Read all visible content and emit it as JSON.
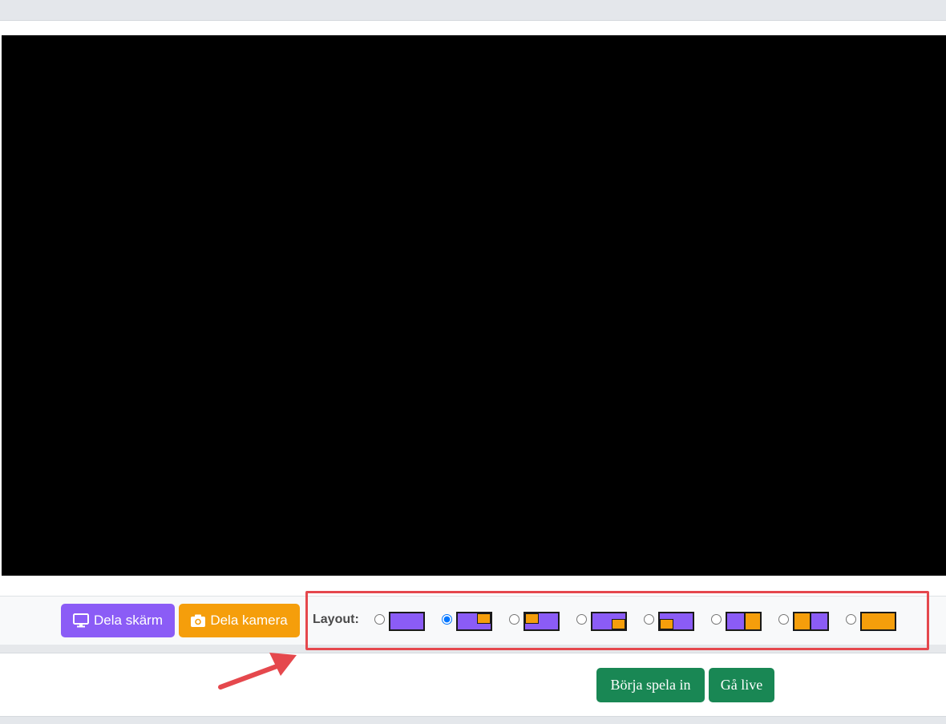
{
  "toolbar": {
    "share_screen_label": "Dela skärm",
    "share_camera_label": "Dela kamera",
    "layout_label": "Layout:",
    "layouts": [
      {
        "id": "screen-only",
        "checked": false
      },
      {
        "id": "pip-top-right",
        "checked": true
      },
      {
        "id": "pip-top-left",
        "checked": false
      },
      {
        "id": "pip-bottom-right",
        "checked": false
      },
      {
        "id": "pip-bottom-left",
        "checked": false
      },
      {
        "id": "split-screen-left",
        "checked": false
      },
      {
        "id": "split-camera-left",
        "checked": false
      },
      {
        "id": "camera-only",
        "checked": false
      }
    ]
  },
  "actions": {
    "record_label": "Börja spela in",
    "live_label": "Gå live"
  },
  "colors": {
    "screen": "#8b5cf6",
    "camera": "#f59e0b",
    "action": "#198754",
    "highlight": "#e5484d"
  }
}
